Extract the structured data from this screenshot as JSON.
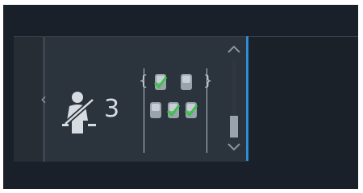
{
  "occupancy": {
    "count": "3",
    "seatbelt_icon": "seatbelt-person-icon"
  },
  "seat_map": {
    "rows": [
      {
        "seats": [
          {
            "belted": true
          },
          {
            "belted": false
          }
        ]
      },
      {
        "seats": [
          {
            "belted": false
          },
          {
            "belted": true
          },
          {
            "belted": true
          }
        ]
      }
    ]
  },
  "scrollbar": {
    "up_icon": "chevron-up-icon",
    "down_icon": "chevron-down-icon"
  },
  "colors": {
    "accent": "#2f8fd6",
    "check": "#3cc24a",
    "panel": "#2b333c",
    "background": "#1a2029"
  }
}
